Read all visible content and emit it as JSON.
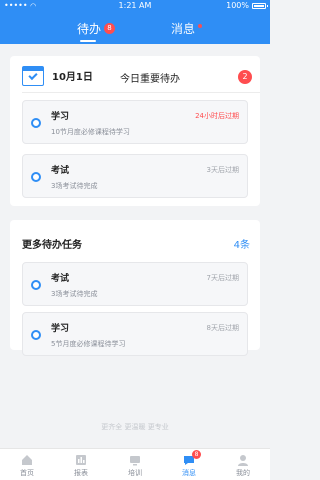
{
  "status_bar": {
    "carrier": "•••••",
    "wifi": "wifi",
    "time": "1:21 AM",
    "battery": "100%"
  },
  "tabs": [
    {
      "label": "待办",
      "badge": "8",
      "active": true
    },
    {
      "label": "消息",
      "dot": true,
      "active": false
    }
  ],
  "today": {
    "date": "10月1日",
    "title": "今日重要待办",
    "count": "2",
    "items": [
      {
        "title": "学习",
        "subtitle": "10节月度必修课程待学习",
        "deadline": "24小时后过期",
        "urgent": true
      },
      {
        "title": "考试",
        "subtitle": "3场考试待完成",
        "deadline": "3天后过期",
        "urgent": false
      }
    ]
  },
  "more": {
    "title": "更多待办任务",
    "count": "4条",
    "items": [
      {
        "title": "考试",
        "subtitle": "3场考试待完成",
        "deadline": "7天后过期"
      },
      {
        "title": "学习",
        "subtitle": "5节月度必修课程待学习",
        "deadline": "8天后过期"
      }
    ]
  },
  "slogan": "更齐全 更温暖 更专业",
  "nav": [
    {
      "label": "首页",
      "icon": "home-icon"
    },
    {
      "label": "报表",
      "icon": "report-icon"
    },
    {
      "label": "培训",
      "icon": "training-icon"
    },
    {
      "label": "消息",
      "icon": "message-icon",
      "badge": "8",
      "active": true
    },
    {
      "label": "我的",
      "icon": "profile-icon"
    }
  ],
  "colors": {
    "primary": "#2f8ef5",
    "alert": "#ff4d4f"
  }
}
